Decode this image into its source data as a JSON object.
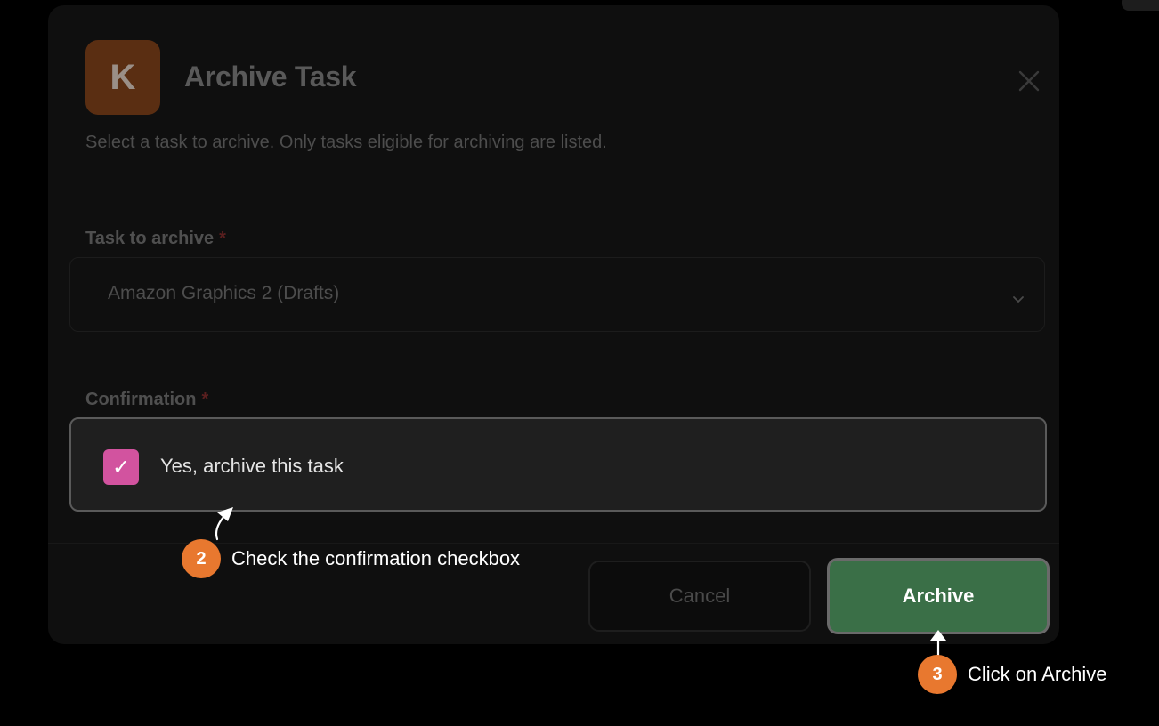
{
  "dialog": {
    "logo_letter": "K",
    "title": "Archive Task",
    "subtitle": "Select a task to archive. Only tasks eligible for archiving are listed.",
    "task_field": {
      "label": "Task to archive",
      "required_mark": "*",
      "selected_value": "Amazon Graphics 2 (Drafts)"
    },
    "confirmation_field": {
      "label": "Confirmation",
      "required_mark": "*",
      "checkbox_checked": true,
      "checkbox_glyph": "✓",
      "checkbox_label": "Yes, archive this task"
    },
    "buttons": {
      "cancel_label": "Cancel",
      "archive_label": "Archive"
    }
  },
  "annotations": [
    {
      "step": "2",
      "text": "Check the confirmation checkbox"
    },
    {
      "step": "3",
      "text": "Click on Archive"
    }
  ],
  "colors": {
    "accent_checkbox": "#d2539f",
    "archive_button": "#3a6f47",
    "callout_badge": "#e8782f",
    "logo_bg": "#5a2e12"
  },
  "icons": {
    "close": "close-icon",
    "dropdown": "chevron-down-icon",
    "check": "check-icon"
  }
}
